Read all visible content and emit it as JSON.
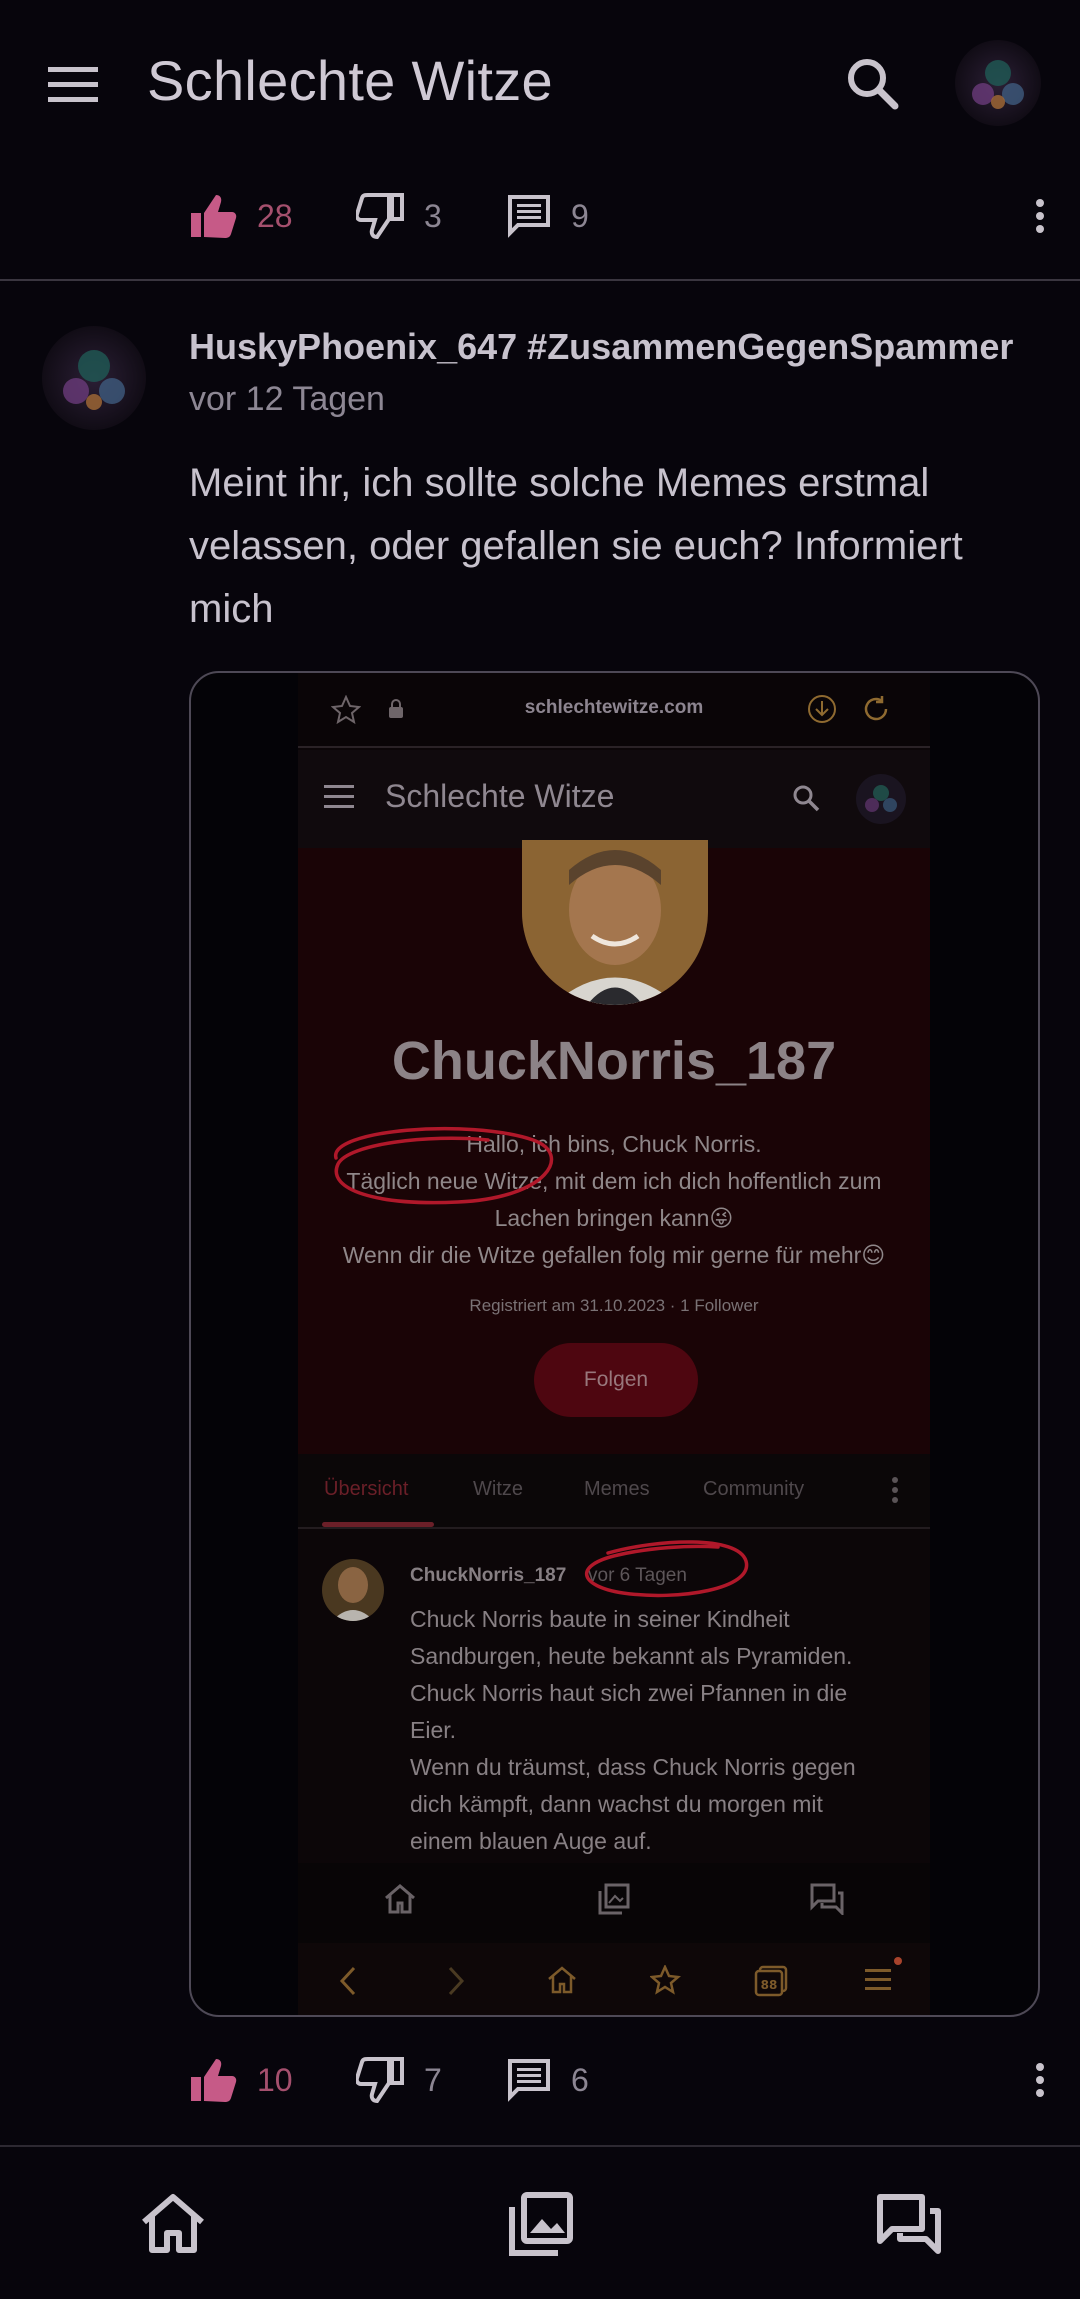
{
  "appbar": {
    "title": "Schlechte Witze",
    "menu_icon": "menu-icon",
    "search_icon": "search-icon"
  },
  "prev_post": {
    "likes": "28",
    "dislikes": "3",
    "comments": "9"
  },
  "post": {
    "username": "HuskyPhoenix_647 #ZusammenGegenSpammer",
    "time": "vor 12 Tagen",
    "text": "Meint ihr, ich sollte solche Memes erstmal velassen, oder gefallen sie euch? Informiert mich",
    "likes": "10",
    "dislikes": "7",
    "comments": "6"
  },
  "screenshot": {
    "url": "schlechtewitze.com",
    "app_title": "Schlechte Witze",
    "profile_name": "ChuckNorris_187",
    "bio_lines": [
      "Hallo, ich bins, Chuck Norris.",
      "Täglich neue Witze, mit dem ich dich hoffentlich zum",
      "Lachen bringen kann😜",
      "Wenn dir die Witze gefallen folg mir gerne für mehr😊"
    ],
    "meta": "Registriert am 31.10.2023 · 1 Follower",
    "follow_label": "Folgen",
    "tabs": [
      "Übersicht",
      "Witze",
      "Memes",
      "Community"
    ],
    "inner_post": {
      "username": "ChuckNorris_187",
      "time": "vor 6 Tagen",
      "lines": [
        "Chuck Norris baute in seiner Kindheit",
        "Sandburgen, heute bekannt als Pyramiden.",
        "Chuck Norris haut sich zwei Pfannen in die",
        "Eier.",
        "Wenn du träumst, dass Chuck Norris gegen",
        "dich kämpft, dann wachst du morgen mit",
        "einem blauen Auge auf."
      ]
    },
    "browser_tab_count": "88"
  },
  "colors": {
    "background": "#07050c",
    "accent": "#a5506e",
    "annotation": "#b0182a"
  }
}
